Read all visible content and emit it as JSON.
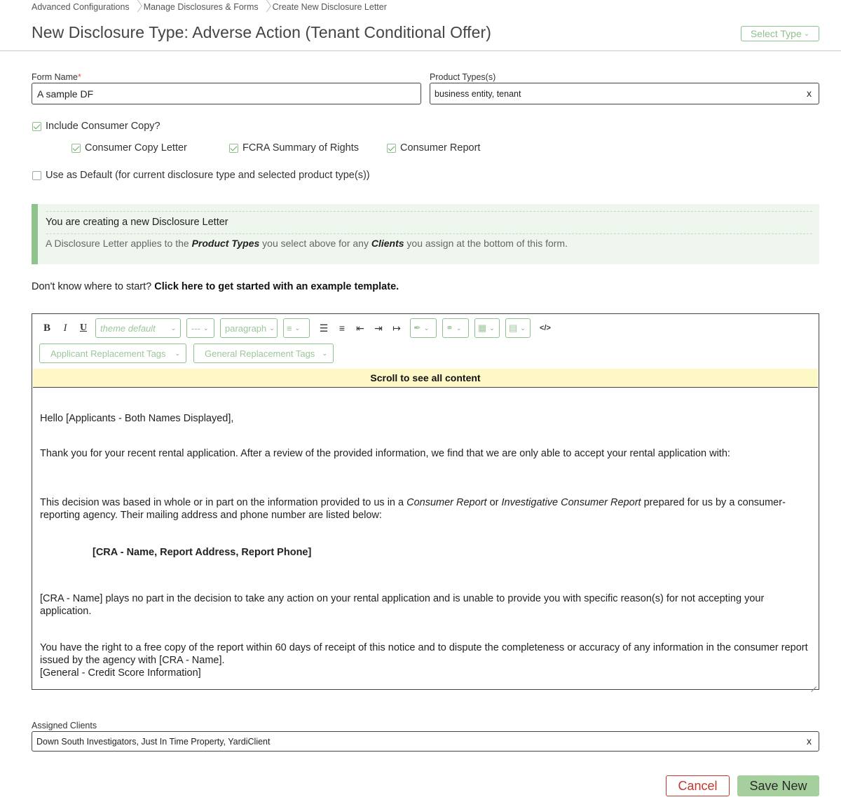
{
  "breadcrumb": [
    "Advanced Configurations",
    "Manage Disclosures & Forms",
    "Create New Disclosure Letter"
  ],
  "page_title": "New Disclosure Type: Adverse Action (Tenant Conditional Offer)",
  "select_type_label": "Select Type",
  "form": {
    "form_name_label": "Form Name",
    "required_mark": "*",
    "form_name_value": "A sample DF",
    "product_types_label": "Product Types(s)",
    "product_types_value": "business entity, tenant",
    "clear_glyph": "x"
  },
  "checkboxes": {
    "include_consumer_copy": {
      "label": "Include Consumer Copy?",
      "checked": true
    },
    "consumer_copy_letter": {
      "label": "Consumer Copy Letter",
      "checked": true
    },
    "fcra_summary": {
      "label": "FCRA Summary of Rights",
      "checked": true
    },
    "consumer_report": {
      "label": "Consumer Report",
      "checked": true
    },
    "use_as_default": {
      "label": "Use as Default (for current disclosure type and selected product type(s))",
      "checked": false
    }
  },
  "info": {
    "title": "You are creating a new Disclosure Letter",
    "desc_1": "A Disclosure Letter applies to the ",
    "desc_bold_1": "Product Types",
    "desc_2": " you select above for any ",
    "desc_bold_2": "Clients",
    "desc_3": " you assign at the bottom of this form."
  },
  "start_hint": {
    "text": "Don't know where to start? ",
    "link": "Click here to get started with an example template."
  },
  "toolbar": {
    "bold": "B",
    "italic": "I",
    "underline": "U",
    "font_dropdown": "theme default",
    "size_dropdown": "---",
    "block_dropdown": "paragraph",
    "applicant_tags": "Applicant Replacement Tags",
    "general_tags": "General Replacement Tags",
    "code": "</>"
  },
  "scroll_banner": "Scroll to see all content",
  "letter": {
    "greeting": "Hello [Applicants - Both Names Displayed],",
    "para1": "Thank you for your recent rental application. After a review of the provided information, we find that we are only able to accept your rental application with:",
    "para2_a": "This decision was based in whole or in part on the information provided to us in a ",
    "para2_i1": "Consumer Report",
    "para2_b": " or ",
    "para2_i2": "Investigative Consumer Report",
    "para2_c": " prepared for us by a consumer-reporting agency. Their mailing address and phone number are listed below:",
    "cra_block": "[CRA - Name, Report Address, Report Phone]",
    "para3": "[CRA - Name] plays no part in the decision to take any action on your rental application and is unable to provide you with specific reason(s) for not accepting your application.",
    "para4": "You have the right to a free copy of the report within 60 days of receipt of this notice and to dispute the completeness or accuracy of any information in the consumer report issued by the agency with [CRA - Name].",
    "para5": "[General - Credit Score Information]"
  },
  "assigned_clients": {
    "label": "Assigned Clients",
    "value": "Down South Investigators, Just In Time Property, YardiClient"
  },
  "actions": {
    "cancel": "Cancel",
    "save": "Save New"
  },
  "colors": {
    "accent_green": "#8fc08f",
    "save_green": "#a6cf9e",
    "cancel_red": "#c0392b",
    "banner_yellow": "#fdf8c6",
    "info_bg": "#eff6ee"
  }
}
